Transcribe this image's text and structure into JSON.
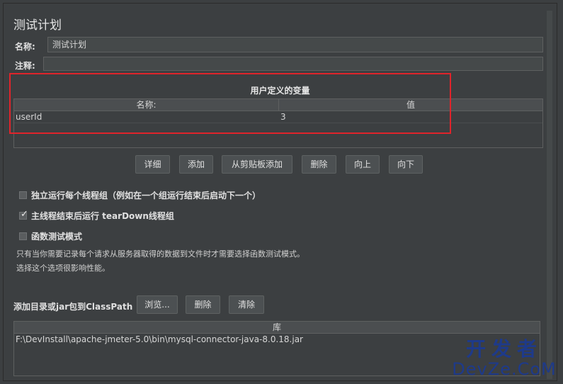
{
  "page": {
    "title": "测试计划"
  },
  "fields": {
    "name_label": "名称:",
    "name_value": "测试计划",
    "comment_label": "注释:",
    "comment_value": ""
  },
  "user_vars": {
    "title": "用户定义的变量",
    "columns": [
      "名称:",
      "值"
    ],
    "rows": [
      {
        "name": "userId",
        "value": "3"
      }
    ]
  },
  "buttons": {
    "detail": "详细",
    "add": "添加",
    "add_from_clipboard": "从剪贴板添加",
    "delete": "删除",
    "up": "向上",
    "down": "向下"
  },
  "options": {
    "run_independent": {
      "label": "独立运行每个线程组（例如在一个组运行结束后启动下一个）",
      "checked": false
    },
    "teardown": {
      "label": "主线程结束后运行 tearDown线程组",
      "checked": true
    },
    "functional": {
      "label": "函数测试模式",
      "checked": false
    }
  },
  "notes": {
    "line1": "只有当你需要记录每个请求从服务器取得的数据到文件时才需要选择函数测试模式。",
    "line2": "选择这个选项很影响性能。"
  },
  "classpath": {
    "label": "添加目录或jar包到ClassPath",
    "browse": "浏览...",
    "delete": "删除",
    "clear": "清除",
    "column": "库",
    "rows": [
      "F:\\DevInstall\\apache-jmeter-5.0\\bin\\mysql-connector-java-8.0.18.jar"
    ]
  },
  "watermark": {
    "cn": "开发者",
    "en": "DevZe.CoM"
  },
  "colors": {
    "highlight": "#e0242b",
    "watermark": "#1e3a8a"
  }
}
